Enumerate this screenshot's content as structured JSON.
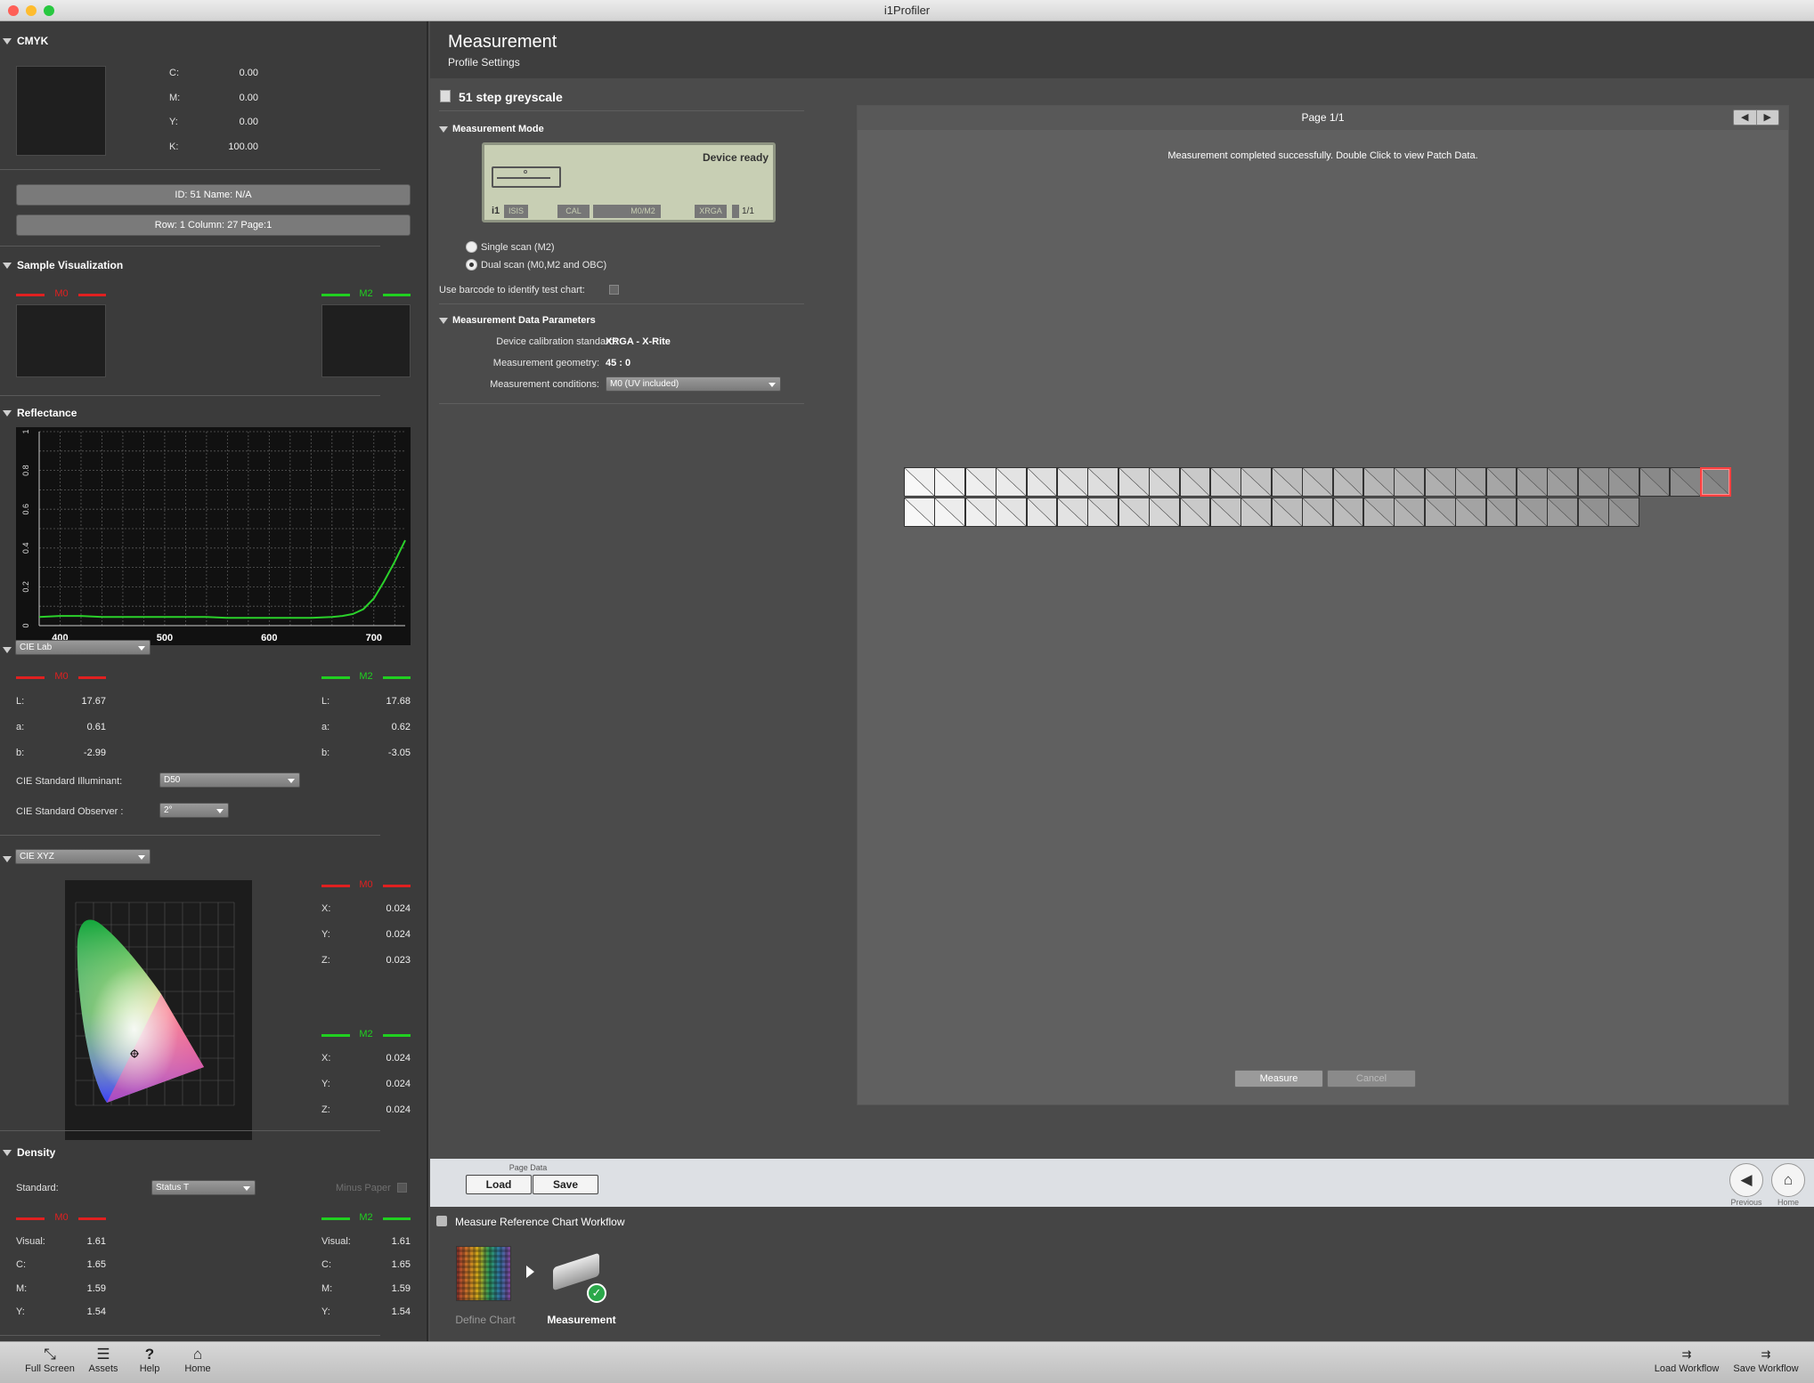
{
  "app": {
    "title": "i1Profiler"
  },
  "left": {
    "cmyk": {
      "header": "CMYK",
      "rows": [
        {
          "label": "C:",
          "value": "0.00"
        },
        {
          "label": "M:",
          "value": "0.00"
        },
        {
          "label": "Y:",
          "value": "0.00"
        },
        {
          "label": "K:",
          "value": "100.00"
        }
      ],
      "id_bar": "ID: 51    Name: N/A",
      "pos_bar": "Row: 1    Column: 27    Page:1"
    },
    "sample": {
      "header": "Sample Visualization",
      "m0": "M0",
      "m2": "M2"
    },
    "reflectance": {
      "header": "Reflectance"
    },
    "lab": {
      "dropdown": "CIE Lab",
      "m0": "M0",
      "m2": "M2",
      "left": [
        {
          "label": "L:",
          "value": "17.67"
        },
        {
          "label": "a:",
          "value": "0.61"
        },
        {
          "label": "b:",
          "value": "-2.99"
        }
      ],
      "right": [
        {
          "label": "L:",
          "value": "17.68"
        },
        {
          "label": "a:",
          "value": "0.62"
        },
        {
          "label": "b:",
          "value": "-3.05"
        }
      ],
      "illuminant_label": "CIE Standard Illuminant:",
      "illuminant": "D50",
      "observer_label": "CIE Standard Observer :",
      "observer": "2°"
    },
    "xyz": {
      "dropdown": "CIE XYZ",
      "m0": "M0",
      "m2": "M2",
      "top": [
        {
          "label": "X:",
          "value": "0.024"
        },
        {
          "label": "Y:",
          "value": "0.024"
        },
        {
          "label": "Z:",
          "value": "0.023"
        }
      ],
      "bottom": [
        {
          "label": "X:",
          "value": "0.024"
        },
        {
          "label": "Y:",
          "value": "0.024"
        },
        {
          "label": "Z:",
          "value": "0.024"
        }
      ]
    },
    "density": {
      "header": "Density",
      "standard_label": "Standard:",
      "standard": "Status T",
      "minus_paper": "Minus Paper",
      "m0": "M0",
      "m2": "M2",
      "left": [
        {
          "label": "Visual:",
          "value": "1.61"
        },
        {
          "label": "C:",
          "value": "1.65"
        },
        {
          "label": "M:",
          "value": "1.59"
        },
        {
          "label": "Y:",
          "value": "1.54"
        }
      ],
      "right": [
        {
          "label": "Visual:",
          "value": "1.61"
        },
        {
          "label": "C:",
          "value": "1.65"
        },
        {
          "label": "M:",
          "value": "1.59"
        },
        {
          "label": "Y:",
          "value": "1.54"
        }
      ]
    }
  },
  "chart_data": {
    "type": "line",
    "title": "",
    "xlabel": "",
    "ylabel": "",
    "x_ticks": [
      "400",
      "500",
      "600",
      "700"
    ],
    "y_ticks": [
      "0",
      "0.2",
      "0.4",
      "0.6",
      "0.8",
      "1"
    ],
    "xlim": [
      380,
      730
    ],
    "ylim": [
      0,
      1
    ],
    "grid": true,
    "series": [
      {
        "values_x": [
          380,
          400,
          420,
          440,
          460,
          480,
          500,
          520,
          540,
          560,
          580,
          600,
          620,
          640,
          660,
          670,
          680,
          690,
          700,
          710,
          720,
          730
        ],
        "values_y": [
          0.045,
          0.05,
          0.05,
          0.045,
          0.045,
          0.045,
          0.045,
          0.045,
          0.045,
          0.04,
          0.04,
          0.04,
          0.04,
          0.04,
          0.045,
          0.05,
          0.06,
          0.085,
          0.14,
          0.23,
          0.33,
          0.44
        ],
        "color": "#2bd12b"
      }
    ]
  },
  "main": {
    "title": "Measurement",
    "subtitle": "Profile Settings",
    "chart_name": "51 step greyscale",
    "mode": {
      "header": "Measurement Mode",
      "device_status": "Device ready",
      "lcd_items": [
        "ISIS",
        "CAL",
        "M0/M2",
        "XRGA",
        "1/1"
      ],
      "single": "Single scan (M2)",
      "dual": "Dual scan (M0,M2 and OBC)",
      "barcode": "Use barcode to identify test chart:"
    },
    "params": {
      "header": "Measurement Data Parameters",
      "cal_label": "Device calibration standard:",
      "cal_value": "XRGA - X-Rite",
      "geom_label": "Measurement geometry:",
      "geom_value": "45 : 0",
      "cond_label": "Measurement conditions:",
      "cond_value": "M0 (UV included)"
    },
    "chart": {
      "page": "Page 1/1",
      "status": "Measurement completed successfully. Double Click to view Patch Data.",
      "row1_count": 27,
      "row2_count": 24,
      "measure": "Measure",
      "cancel": "Cancel"
    },
    "pagedata": {
      "label": "Page Data",
      "load": "Load",
      "save": "Save",
      "previous": "Previous",
      "home": "Home"
    },
    "workflow": {
      "title": "Measure Reference Chart Workflow",
      "define": "Define Chart",
      "measurement": "Measurement"
    }
  },
  "bottom": {
    "full_screen": "Full Screen",
    "assets": "Assets",
    "help": "Help",
    "home": "Home",
    "load_workflow": "Load Workflow",
    "save_workflow": "Save Workflow"
  }
}
